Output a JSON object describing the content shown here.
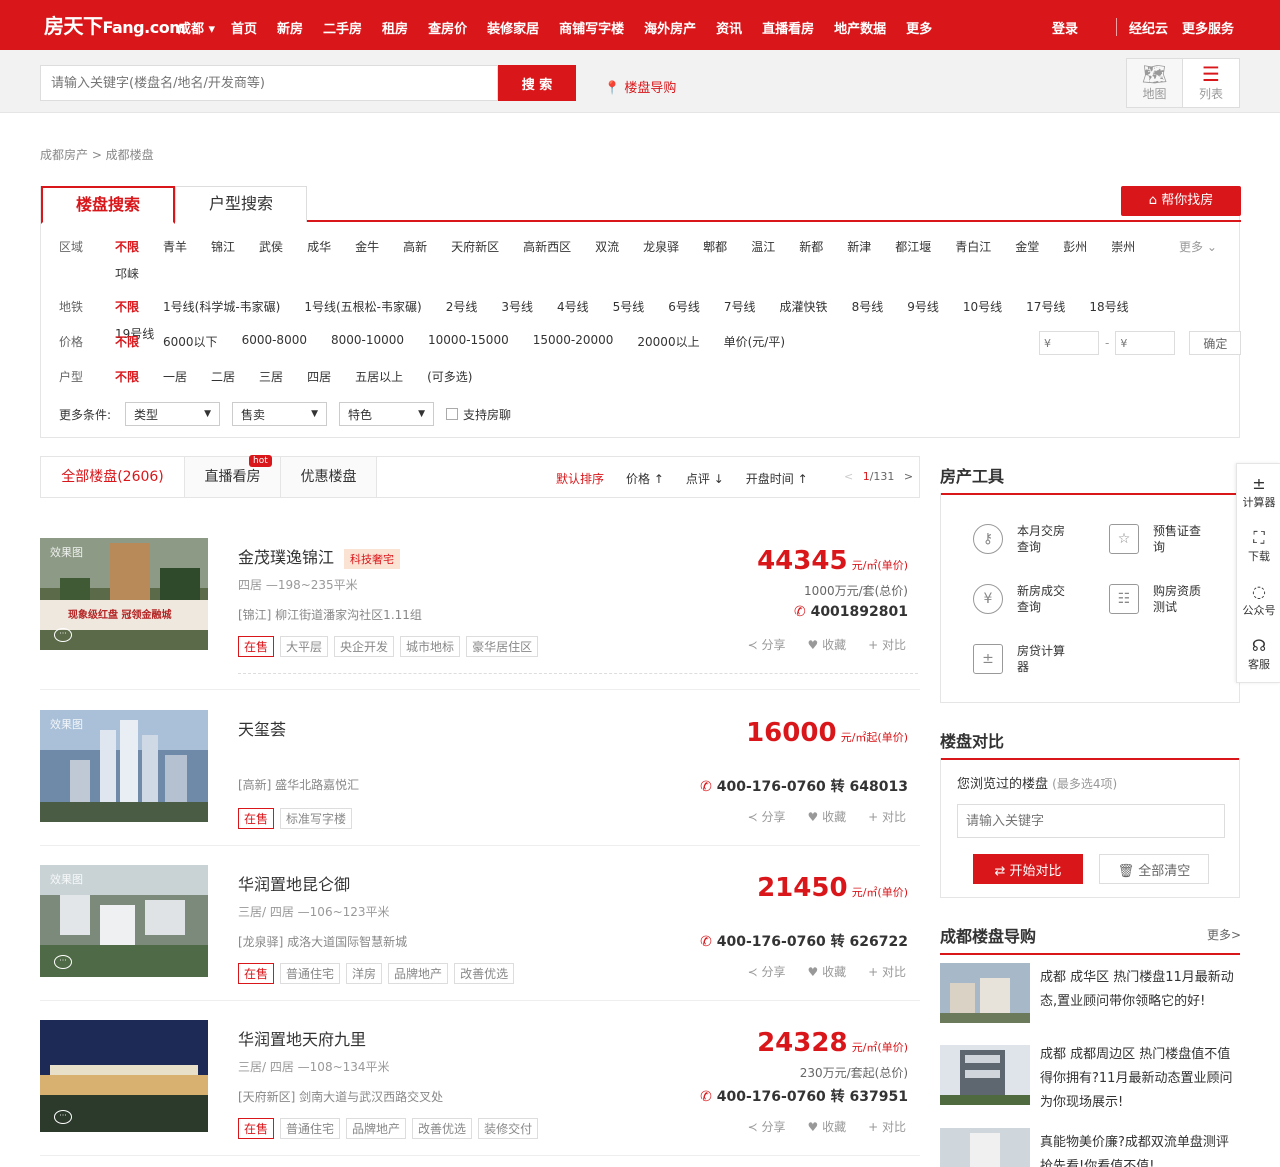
{
  "nav": {
    "logo_main": "房天下",
    "logo_sub": "Fang.com",
    "city": "成都 ▾",
    "items": [
      "首页",
      "新房",
      "二手房",
      "租房",
      "查房价",
      "装修家居",
      "商铺写字楼",
      "海外房产",
      "资讯",
      "直播看房",
      "地产数据",
      "更多"
    ],
    "login": "登录",
    "broker": "经纪云",
    "more_services": "更多服务"
  },
  "search": {
    "placeholder": "请输入关键字(楼盘名/地名/开发商等)",
    "button": "搜 索",
    "guide": "楼盘导购",
    "map_label": "地图",
    "list_label": "列表"
  },
  "breadcrumb": "成都房产 > 成都楼盘",
  "filter": {
    "tab_active": "楼盘搜索",
    "tab_2": "户型搜索",
    "help_button": "帮你找房",
    "more": "更多",
    "rows": [
      {
        "label": "区域",
        "options": [
          "不限",
          "青羊",
          "锦江",
          "武侯",
          "成华",
          "金牛",
          "高新",
          "天府新区",
          "高新西区",
          "双流",
          "龙泉驿",
          "郫都",
          "温江",
          "新都",
          "新津",
          "都江堰",
          "青白江",
          "金堂",
          "彭州",
          "崇州",
          "邛崃"
        ]
      },
      {
        "label": "地铁",
        "options": [
          "不限",
          "1号线(科学城-韦家碾)",
          "1号线(五根松-韦家碾)",
          "2号线",
          "3号线",
          "4号线",
          "5号线",
          "6号线",
          "7号线",
          "成灌快铁",
          "8号线",
          "9号线",
          "10号线",
          "17号线",
          "18号线",
          "19号线"
        ]
      },
      {
        "label": "价格",
        "options": [
          "不限",
          "6000以下",
          "6000-8000",
          "8000-10000",
          "10000-15000",
          "15000-20000",
          "20000以上",
          "单价(元/平)"
        ]
      },
      {
        "label": "户型",
        "options": [
          "不限",
          "一居",
          "二居",
          "三居",
          "四居",
          "五居以上",
          "(可多选)"
        ]
      }
    ],
    "price_min_placeholder": "¥",
    "price_max_placeholder": "¥",
    "price_dash": "-",
    "confirm": "确定",
    "more_label": "更多条件:",
    "selects": [
      "类型",
      "售卖",
      "特色"
    ],
    "checkbox_label": "支持房聊"
  },
  "list_tabs": {
    "all": "全部楼盘(2606)",
    "live": "直播看房",
    "hot": "hot",
    "deals": "优惠楼盘",
    "sort_default": "默认排序",
    "sort_price": "价格 ↑",
    "sort_rating": "点评 ↓",
    "sort_open": "开盘时间 ↑",
    "page_prev": "<",
    "page_cur": "1",
    "page_total": "/131",
    "page_next": ">"
  },
  "listings": [
    {
      "name": "金茂璞逸锦江",
      "badge": "科技奢宅",
      "sub": "四居 —198~235平米",
      "addr": "[锦江] 柳江街道潘家沟社区1.11组",
      "price": "44345",
      "price_unit": "元/㎡(单价)",
      "total": "1000万元/套(总价)",
      "phone": "4001892801",
      "tags": [
        "在售",
        "大平层",
        "央企开发",
        "城市地标",
        "豪华居住区"
      ],
      "img_tag": "效果图",
      "img_caption": "现象级红盘  冠领金融城"
    },
    {
      "name": "天玺荟",
      "badge": "",
      "sub": "",
      "addr": "[高新] 盛华北路嘉悦汇",
      "price": "16000",
      "price_unit": "元/㎡起(单价)",
      "total": "",
      "phone": "400-176-0760 转 648013",
      "tags": [
        "在售",
        "标准写字楼"
      ],
      "img_tag": "效果图",
      "img_caption": ""
    },
    {
      "name": "华润置地昆仑御",
      "badge": "",
      "sub": "三居/ 四居 —106~123平米",
      "addr": "[龙泉驿] 成洛大道国际智慧新城",
      "price": "21450",
      "price_unit": "元/㎡(单价)",
      "total": "",
      "phone": "400-176-0760 转 626722",
      "tags": [
        "在售",
        "普通住宅",
        "洋房",
        "品牌地产",
        "改善优选"
      ],
      "img_tag": "效果图",
      "img_caption": ""
    },
    {
      "name": "华润置地天府九里",
      "badge": "",
      "sub": "三居/ 四居 —108~134平米",
      "addr": "[天府新区] 剑南大道与武汉西路交叉处",
      "price": "24328",
      "price_unit": "元/㎡(单价)",
      "total": "230万元/套起(总价)",
      "phone": "400-176-0760 转 637951",
      "tags": [
        "在售",
        "普通住宅",
        "品牌地产",
        "改善优选",
        "装修交付"
      ],
      "img_tag": "",
      "img_caption": ""
    }
  ],
  "actions": {
    "share": "分享",
    "fav": "收藏",
    "compare": "对比"
  },
  "sidebar": {
    "tools_title": "房产工具",
    "tools": [
      {
        "label": "本月交房查询",
        "icon": "key-icon"
      },
      {
        "label": "预售证查询",
        "icon": "certificate-icon"
      },
      {
        "label": "新房成交查询",
        "icon": "yuan-icon"
      },
      {
        "label": "购房资质测试",
        "icon": "checklist-icon"
      },
      {
        "label": "房贷计算器",
        "icon": "calculator-icon"
      }
    ],
    "compare_title": "楼盘对比",
    "compare_hint": "您浏览过的楼盘",
    "compare_hint_sub": "(最多选4项)",
    "compare_placeholder": "请输入关键字",
    "compare_start": "⇄  开始对比",
    "compare_clear": "🗑  全部清空",
    "guide_title": "成都楼盘导购",
    "guide_more": "更多>",
    "guides": [
      "成都 成华区 热门楼盘11月最新动态,置业顾问带你领略它的好!",
      "成都 成都周边区 热门楼盘值不值得你拥有?11月最新动态置业顾问为你现场展示!",
      "真能物美价廉?成都双流单盘测评抢先看!你看值不值!"
    ]
  },
  "floatbar": {
    "items": [
      "计算器",
      "下载",
      "公众号",
      "客服"
    ]
  }
}
